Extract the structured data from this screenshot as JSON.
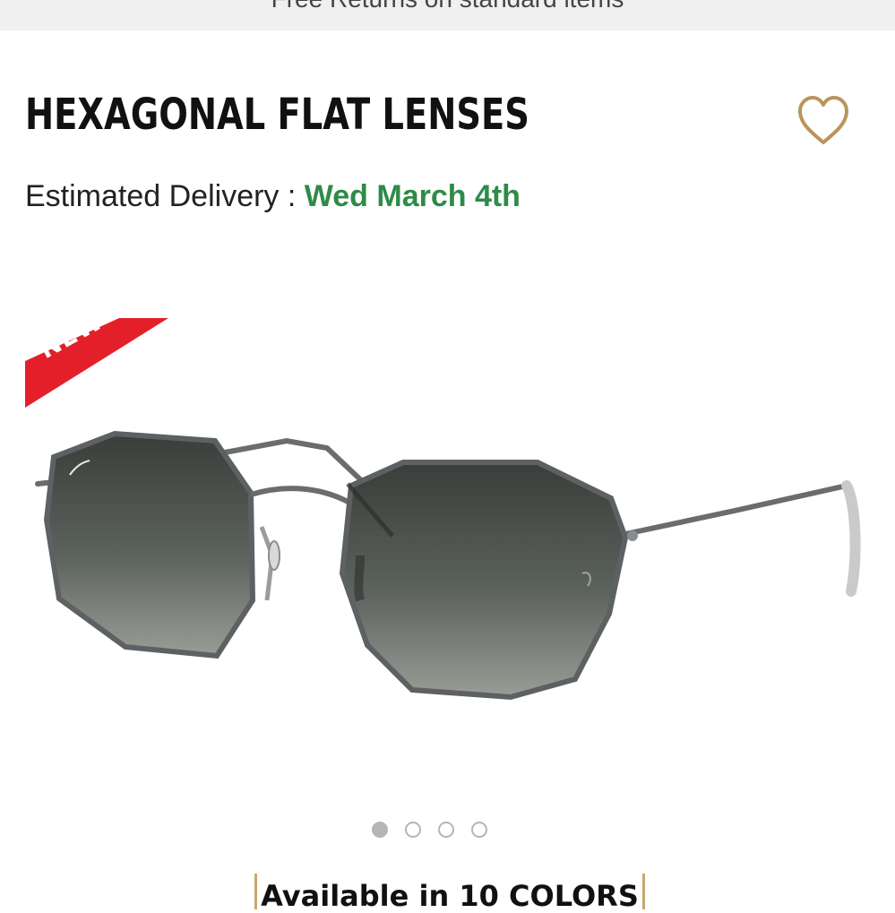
{
  "promo_bar": {
    "text": "Free Returns on standard items"
  },
  "product": {
    "title": "HEXAGONAL FLAT LENSES",
    "badge": "NEW",
    "badge_color": "#e3202a",
    "wishlist_icon": "heart-outline-icon",
    "wishlist_color": "#b8955a"
  },
  "delivery": {
    "label": "Estimated Delivery : ",
    "date": "Wed March 4th",
    "date_color": "#2e8b48"
  },
  "gallery": {
    "image": "sunglasses-image",
    "total_slides": 4,
    "active_slide": 1
  },
  "colors": {
    "text": "Available in 10 COLORS"
  }
}
